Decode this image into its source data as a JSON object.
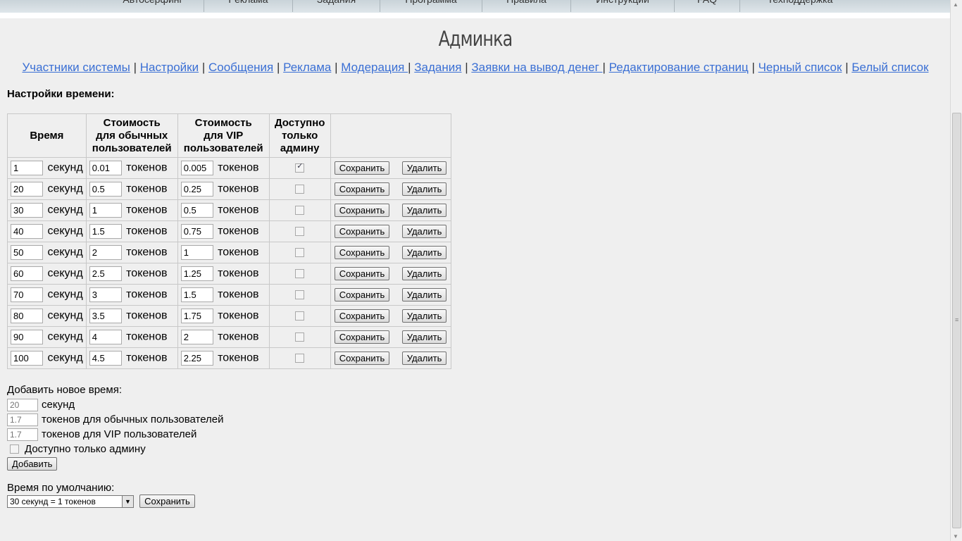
{
  "topnav": {
    "items": [
      "Автосерфинг",
      "Реклама",
      "Задания",
      "Программа",
      "Правила",
      "Инструкции",
      "FAQ",
      "Техподдержка"
    ]
  },
  "page": {
    "title": "Админка"
  },
  "adminnav": {
    "links": [
      "Участники системы",
      "Настройки",
      "Сообщения",
      "Реклама",
      "Модерация ",
      "Задания",
      "Заявки на вывод денег ",
      "Редактирование страниц",
      "Черный список",
      "Белый список"
    ],
    "separator": "|"
  },
  "time_settings": {
    "title": "Настройки времени:",
    "headers": {
      "time": "Время",
      "cost_regular": [
        "Стоимость",
        "для обычных",
        "пользователей"
      ],
      "cost_vip": [
        "Стоимость",
        "для VIP",
        "пользователей"
      ],
      "admin_only": [
        "Доступно",
        "только",
        "админу"
      ]
    },
    "unit_seconds": "секунд",
    "unit_tokens": "токенов",
    "save_label": "Сохранить",
    "delete_label": "Удалить",
    "rows": [
      {
        "seconds": "1",
        "regular": "0.01",
        "vip": "0.005",
        "admin_only": true
      },
      {
        "seconds": "20",
        "regular": "0.5",
        "vip": "0.25",
        "admin_only": false
      },
      {
        "seconds": "30",
        "regular": "1",
        "vip": "0.5",
        "admin_only": false
      },
      {
        "seconds": "40",
        "regular": "1.5",
        "vip": "0.75",
        "admin_only": false
      },
      {
        "seconds": "50",
        "regular": "2",
        "vip": "1",
        "admin_only": false
      },
      {
        "seconds": "60",
        "regular": "2.5",
        "vip": "1.25",
        "admin_only": false
      },
      {
        "seconds": "70",
        "regular": "3",
        "vip": "1.5",
        "admin_only": false
      },
      {
        "seconds": "80",
        "regular": "3.5",
        "vip": "1.75",
        "admin_only": false
      },
      {
        "seconds": "90",
        "regular": "4",
        "vip": "2",
        "admin_only": false
      },
      {
        "seconds": "100",
        "regular": "4.5",
        "vip": "2.25",
        "admin_only": false
      }
    ]
  },
  "add_time": {
    "title": "Добавить новое время:",
    "seconds_placeholder": "20",
    "seconds_label": "секунд",
    "regular_placeholder": "1.7",
    "regular_label": "токенов для обычных пользователей",
    "vip_placeholder": "1.7",
    "vip_label": "токенов для VIP пользователей",
    "admin_only_label": "Доступно только админу",
    "add_label": "Добавить"
  },
  "default_time": {
    "title": "Время по умолчанию:",
    "selected": "30 секунд = 1 токенов",
    "save_label": "Сохранить"
  }
}
